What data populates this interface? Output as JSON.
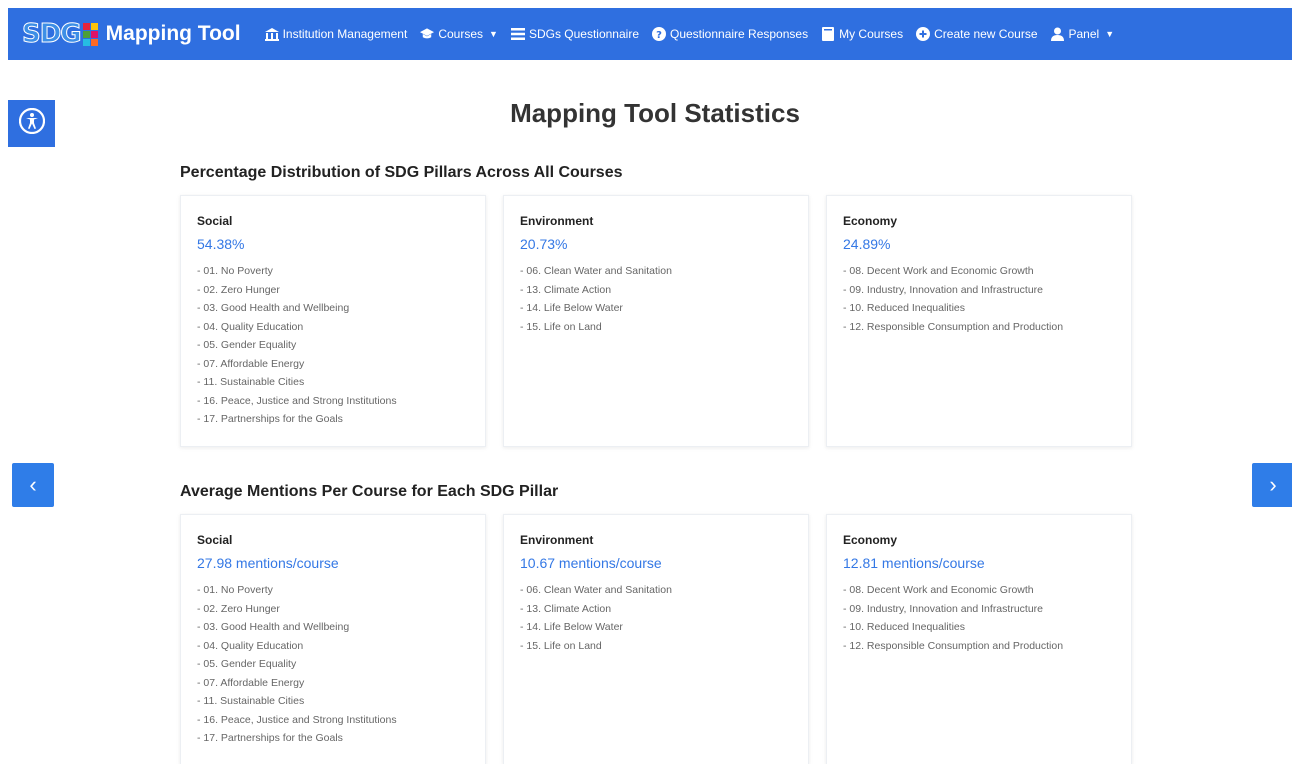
{
  "navbar": {
    "logo_text": "SDG",
    "brand_title": "Mapping Tool",
    "items": [
      {
        "label": "Institution Management",
        "icon": "institution-icon",
        "dropdown": false
      },
      {
        "label": "Courses",
        "icon": "graduation-cap-icon",
        "dropdown": true
      },
      {
        "label": "SDGs Questionnaire",
        "icon": "list-icon",
        "dropdown": false
      },
      {
        "label": "Questionnaire Responses",
        "icon": "question-circle-icon",
        "dropdown": false
      },
      {
        "label": "My Courses",
        "icon": "book-icon",
        "dropdown": false
      },
      {
        "label": "Create new Course",
        "icon": "plus-circle-icon",
        "dropdown": false
      },
      {
        "label": "Panel",
        "icon": "user-icon",
        "dropdown": true
      }
    ]
  },
  "page_title": "Mapping Tool Statistics",
  "sections": [
    {
      "title": "Percentage Distribution of SDG Pillars Across All Courses",
      "cards": [
        {
          "title": "Social",
          "value": "54.38%",
          "goals": [
            "- 01. No Poverty",
            "- 02. Zero Hunger",
            "- 03. Good Health and Wellbeing",
            "- 04. Quality Education",
            "- 05. Gender Equality",
            "- 07. Affordable Energy",
            "- 11. Sustainable Cities",
            "- 16. Peace, Justice and Strong Institutions",
            "- 17. Partnerships for the Goals"
          ]
        },
        {
          "title": "Environment",
          "value": "20.73%",
          "goals": [
            "- 06. Clean Water and Sanitation",
            "- 13. Climate Action",
            "- 14. Life Below Water",
            "- 15. Life on Land"
          ]
        },
        {
          "title": "Economy",
          "value": "24.89%",
          "goals": [
            "- 08. Decent Work and Economic Growth",
            "- 09. Industry, Innovation and Infrastructure",
            "- 10. Reduced Inequalities",
            "- 12. Responsible Consumption and Production"
          ]
        }
      ]
    },
    {
      "title": "Average Mentions Per Course for Each SDG Pillar",
      "cards": [
        {
          "title": "Social",
          "value": "27.98 mentions/course",
          "goals": [
            "- 01. No Poverty",
            "- 02. Zero Hunger",
            "- 03. Good Health and Wellbeing",
            "- 04. Quality Education",
            "- 05. Gender Equality",
            "- 07. Affordable Energy",
            "- 11. Sustainable Cities",
            "- 16. Peace, Justice and Strong Institutions",
            "- 17. Partnerships for the Goals"
          ]
        },
        {
          "title": "Environment",
          "value": "10.67 mentions/course",
          "goals": [
            "- 06. Clean Water and Sanitation",
            "- 13. Climate Action",
            "- 14. Life Below Water",
            "- 15. Life on Land"
          ]
        },
        {
          "title": "Economy",
          "value": "12.81 mentions/course",
          "goals": [
            "- 08. Decent Work and Economic Growth",
            "- 09. Industry, Innovation and Infrastructure",
            "- 10. Reduced Inequalities",
            "- 12. Responsible Consumption and Production"
          ]
        }
      ]
    }
  ],
  "controls": {
    "accessibility_icon": "accessibility-icon",
    "prev_icon": "chevron-left-icon",
    "next_icon": "chevron-right-icon",
    "prev_glyph": "‹",
    "next_glyph": "›"
  },
  "colors": {
    "navbar": "#2f6fe0",
    "accent": "#3478e5"
  }
}
